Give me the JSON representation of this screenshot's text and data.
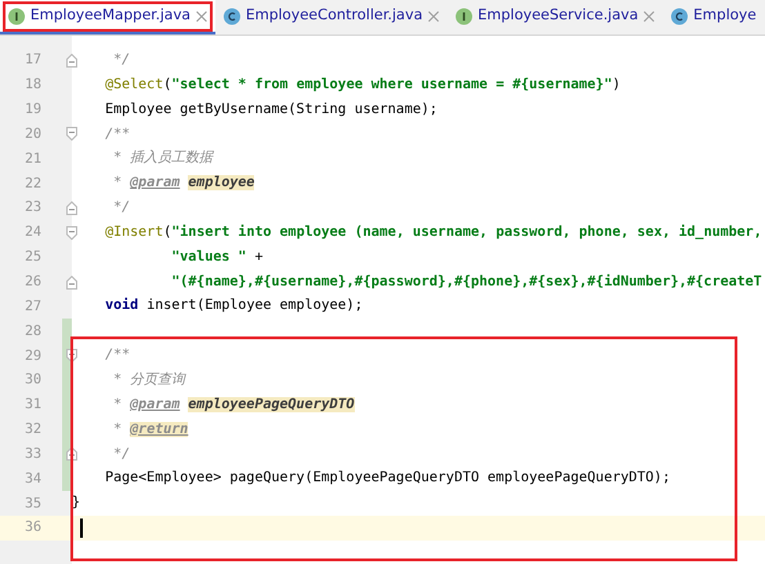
{
  "tabs": [
    {
      "label": "EmployeeMapper.java",
      "kind": "interface",
      "selected": true,
      "closable": true,
      "marked": true
    },
    {
      "label": "EmployeeController.java",
      "kind": "class",
      "selected": false,
      "closable": true,
      "marked": false
    },
    {
      "label": "EmployeeService.java",
      "kind": "interface",
      "selected": false,
      "closable": true,
      "marked": false
    },
    {
      "label": "Employe",
      "kind": "class",
      "selected": false,
      "closable": false,
      "marked": false
    }
  ],
  "lines": [
    {
      "number": "17",
      "fold_open": false,
      "fold_close": true,
      "changed": false,
      "marked": false,
      "current": false,
      "tokens": [
        {
          "kind": "comment",
          "text": "     */"
        }
      ]
    },
    {
      "number": "18",
      "fold_open": false,
      "fold_close": false,
      "changed": false,
      "marked": false,
      "current": false,
      "tokens": [
        {
          "kind": "annotation",
          "text": "    @Select"
        },
        {
          "kind": "plain",
          "text": "("
        },
        {
          "kind": "string",
          "text": "\"select * from employee where username = #{username}\""
        },
        {
          "kind": "plain",
          "text": ")"
        }
      ]
    },
    {
      "number": "19",
      "fold_open": false,
      "fold_close": false,
      "changed": false,
      "marked": false,
      "current": false,
      "tokens": [
        {
          "kind": "plain",
          "text": "    Employee getByUsername(String username);"
        }
      ]
    },
    {
      "number": "20",
      "fold_open": true,
      "fold_close": false,
      "changed": false,
      "marked": false,
      "current": false,
      "tokens": [
        {
          "kind": "comment",
          "text": "    /**"
        }
      ]
    },
    {
      "number": "21",
      "fold_open": false,
      "fold_close": false,
      "changed": false,
      "marked": false,
      "current": false,
      "tokens": [
        {
          "kind": "comment",
          "text": "     * 插入员工数据"
        }
      ]
    },
    {
      "number": "22",
      "fold_open": false,
      "fold_close": false,
      "changed": false,
      "marked": false,
      "current": false,
      "tokens": [
        {
          "kind": "comment",
          "text": "     * "
        },
        {
          "kind": "doc_tag",
          "text": "@param"
        },
        {
          "kind": "doc_param",
          "text": "employee"
        }
      ]
    },
    {
      "number": "23",
      "fold_open": false,
      "fold_close": true,
      "changed": false,
      "marked": false,
      "current": false,
      "tokens": [
        {
          "kind": "comment",
          "text": "     */"
        }
      ]
    },
    {
      "number": "24",
      "fold_open": true,
      "fold_close": false,
      "changed": false,
      "marked": false,
      "current": false,
      "tokens": [
        {
          "kind": "annotation",
          "text": "    @Insert"
        },
        {
          "kind": "plain",
          "text": "("
        },
        {
          "kind": "string",
          "text": "\"insert into employee (name, username, password, phone, sex, id_number,"
        }
      ]
    },
    {
      "number": "25",
      "fold_open": false,
      "fold_close": false,
      "changed": false,
      "marked": false,
      "current": false,
      "tokens": [
        {
          "kind": "string",
          "text": "            \"values \""
        },
        {
          "kind": "plain",
          "text": " +"
        }
      ]
    },
    {
      "number": "26",
      "fold_open": false,
      "fold_close": true,
      "changed": false,
      "marked": false,
      "current": false,
      "tokens": [
        {
          "kind": "string",
          "text": "            \"(#{name},#{username},#{password},#{phone},#{sex},#{idNumber},#{createT"
        }
      ]
    },
    {
      "number": "27",
      "fold_open": false,
      "fold_close": false,
      "changed": false,
      "marked": false,
      "current": false,
      "tokens": [
        {
          "kind": "keyword",
          "text": "    void"
        },
        {
          "kind": "plain",
          "text": " insert(Employee employee);"
        }
      ]
    },
    {
      "number": "28",
      "fold_open": false,
      "fold_close": false,
      "changed": true,
      "marked": false,
      "current": false
    },
    {
      "number": "29",
      "fold_open": true,
      "fold_close": false,
      "changed": true,
      "marked": true,
      "current": false,
      "tokens": [
        {
          "kind": "comment",
          "text": "    /**"
        }
      ]
    },
    {
      "number": "30",
      "fold_open": false,
      "fold_close": false,
      "changed": true,
      "marked": true,
      "current": false,
      "tokens": [
        {
          "kind": "comment",
          "text": "     * 分页查询"
        }
      ]
    },
    {
      "number": "31",
      "fold_open": false,
      "fold_close": false,
      "changed": true,
      "marked": true,
      "current": false,
      "tokens": [
        {
          "kind": "comment",
          "text": "     * "
        },
        {
          "kind": "doc_tag",
          "text": "@param"
        },
        {
          "kind": "doc_param",
          "text": "employeePageQueryDTO"
        }
      ]
    },
    {
      "number": "32",
      "fold_open": false,
      "fold_close": false,
      "changed": true,
      "marked": true,
      "current": false,
      "tokens": [
        {
          "kind": "comment",
          "text": "     * "
        },
        {
          "kind": "doc_tag_hl",
          "text": "@return"
        }
      ]
    },
    {
      "number": "33",
      "fold_open": false,
      "fold_close": true,
      "changed": true,
      "marked": true,
      "current": false,
      "tokens": [
        {
          "kind": "comment",
          "text": "     */"
        }
      ]
    },
    {
      "number": "34",
      "fold_open": false,
      "fold_close": false,
      "changed": true,
      "marked": true,
      "current": false,
      "tokens": [
        {
          "kind": "plain",
          "text": "    Page<Employee> pageQuery(EmployeePageQueryDTO employeePageQueryDTO);"
        }
      ]
    },
    {
      "number": "35",
      "fold_open": false,
      "fold_close": false,
      "changed": false,
      "marked": true,
      "current": false,
      "tokens": [
        {
          "kind": "plain",
          "text": "}"
        }
      ]
    },
    {
      "number": "36",
      "fold_open": false,
      "fold_close": false,
      "changed": false,
      "marked": true,
      "current": true
    }
  ]
}
